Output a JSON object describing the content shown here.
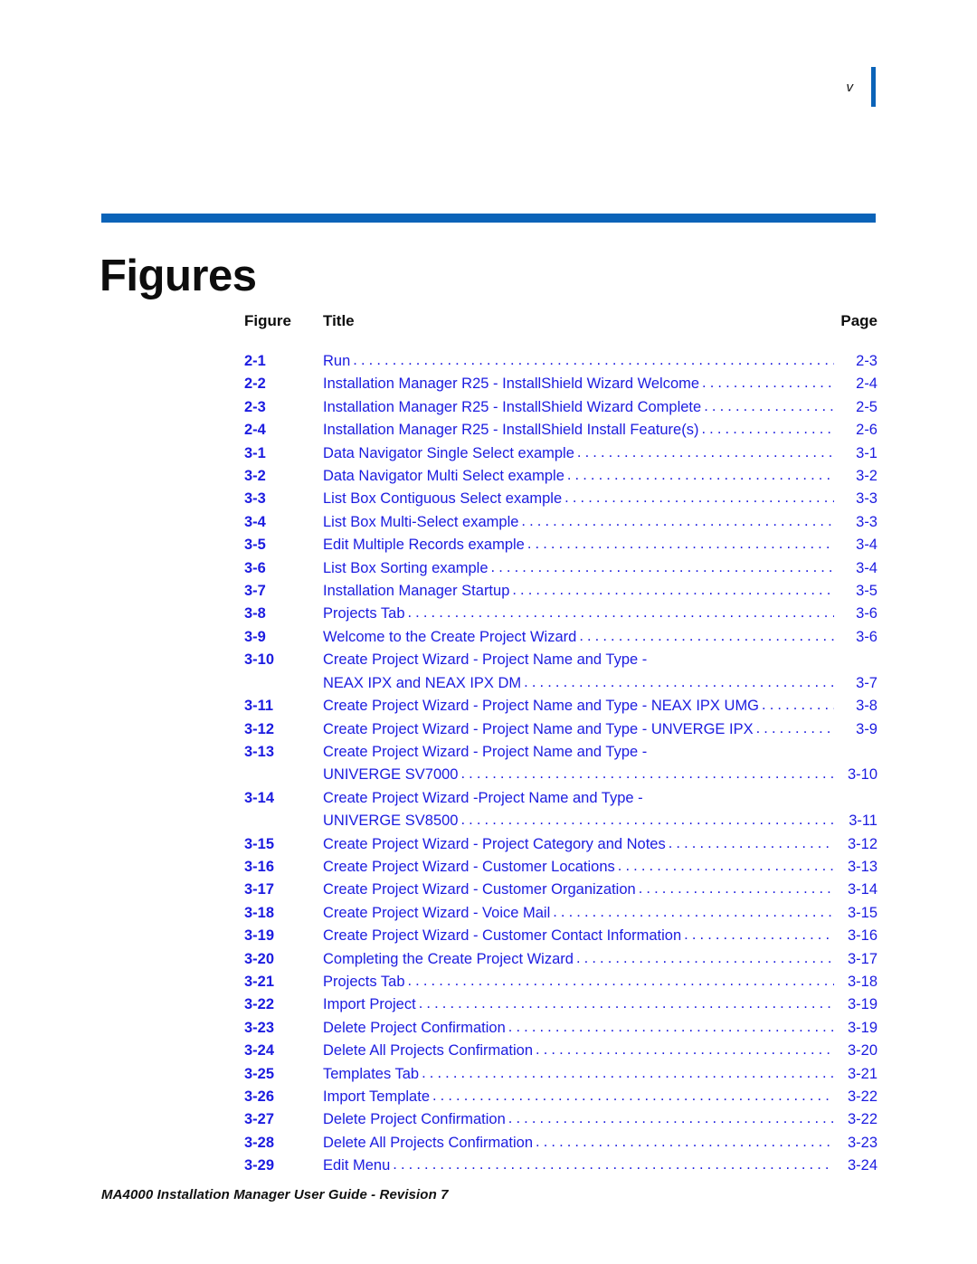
{
  "document": {
    "folio": "v",
    "chapter_title": "Figures",
    "footer": "MA4000 Installation Manager User Guide - Revision 7"
  },
  "colors": {
    "rule_blue": "#0b63b8",
    "entry_blue": "#1c1ce0",
    "heading_black": "#0d0d0d"
  },
  "table": {
    "headers": {
      "figure": "Figure",
      "title": "Title",
      "page": "Page"
    },
    "rows": [
      {
        "figure": "2-1",
        "lines": [
          "Run"
        ],
        "page": "2-3"
      },
      {
        "figure": "2-2",
        "lines": [
          "Installation Manager R25 - InstallShield Wizard Welcome"
        ],
        "page": "2-4"
      },
      {
        "figure": "2-3",
        "lines": [
          "Installation Manager R25 - InstallShield Wizard Complete"
        ],
        "page": "2-5"
      },
      {
        "figure": "2-4",
        "lines": [
          "Installation Manager R25 - InstallShield Install Feature(s)"
        ],
        "page": "2-6"
      },
      {
        "figure": "3-1",
        "lines": [
          "Data Navigator Single Select example"
        ],
        "page": "3-1"
      },
      {
        "figure": "3-2",
        "lines": [
          "Data Navigator Multi Select example"
        ],
        "page": "3-2"
      },
      {
        "figure": "3-3",
        "lines": [
          "List Box Contiguous Select example"
        ],
        "page": "3-3"
      },
      {
        "figure": "3-4",
        "lines": [
          "List Box Multi-Select example"
        ],
        "page": "3-3"
      },
      {
        "figure": "3-5",
        "lines": [
          "Edit Multiple Records example"
        ],
        "page": "3-4"
      },
      {
        "figure": "3-6",
        "lines": [
          "List Box Sorting example"
        ],
        "page": "3-4"
      },
      {
        "figure": "3-7",
        "lines": [
          "Installation Manager Startup"
        ],
        "page": "3-5"
      },
      {
        "figure": "3-8",
        "lines": [
          "Projects Tab"
        ],
        "page": "3-6"
      },
      {
        "figure": "3-9",
        "lines": [
          "Welcome to the Create Project Wizard"
        ],
        "page": "3-6"
      },
      {
        "figure": "3-10",
        "lines": [
          "Create Project Wizard - Project Name and Type -",
          "NEAX IPX and NEAX IPX DM"
        ],
        "page": "3-7"
      },
      {
        "figure": "3-11",
        "lines": [
          "Create Project Wizard - Project Name and Type - NEAX IPX UMG"
        ],
        "page": "3-8"
      },
      {
        "figure": "3-12",
        "lines": [
          "Create Project Wizard - Project Name and Type - UNVERGE IPX"
        ],
        "page": "3-9"
      },
      {
        "figure": "3-13",
        "lines": [
          "Create Project Wizard - Project Name and Type -",
          "UNIVERGE SV7000"
        ],
        "page": "3-10"
      },
      {
        "figure": "3-14",
        "lines": [
          "Create Project Wizard -Project Name and Type -",
          "UNIVERGE SV8500"
        ],
        "page": "3-11"
      },
      {
        "figure": "3-15",
        "lines": [
          "Create Project Wizard - Project Category and Notes"
        ],
        "page": "3-12"
      },
      {
        "figure": "3-16",
        "lines": [
          "Create Project Wizard - Customer Locations"
        ],
        "page": "3-13"
      },
      {
        "figure": "3-17",
        "lines": [
          "Create Project Wizard - Customer Organization"
        ],
        "page": "3-14"
      },
      {
        "figure": "3-18",
        "lines": [
          "Create Project Wizard - Voice Mail"
        ],
        "page": "3-15"
      },
      {
        "figure": "3-19",
        "lines": [
          "Create Project Wizard - Customer Contact Information"
        ],
        "page": "3-16"
      },
      {
        "figure": "3-20",
        "lines": [
          "Completing the Create Project Wizard"
        ],
        "page": "3-17"
      },
      {
        "figure": "3-21",
        "lines": [
          "Projects Tab"
        ],
        "page": "3-18"
      },
      {
        "figure": "3-22",
        "lines": [
          "Import Project"
        ],
        "page": "3-19"
      },
      {
        "figure": "3-23",
        "lines": [
          "Delete Project Confirmation"
        ],
        "page": "3-19"
      },
      {
        "figure": "3-24",
        "lines": [
          "Delete All Projects Confirmation"
        ],
        "page": "3-20"
      },
      {
        "figure": "3-25",
        "lines": [
          "Templates Tab"
        ],
        "page": "3-21"
      },
      {
        "figure": "3-26",
        "lines": [
          "Import Template"
        ],
        "page": "3-22"
      },
      {
        "figure": "3-27",
        "lines": [
          "Delete Project Confirmation"
        ],
        "page": "3-22"
      },
      {
        "figure": "3-28",
        "lines": [
          "Delete All Projects Confirmation"
        ],
        "page": "3-23"
      },
      {
        "figure": "3-29",
        "lines": [
          "Edit Menu"
        ],
        "page": "3-24"
      }
    ]
  }
}
